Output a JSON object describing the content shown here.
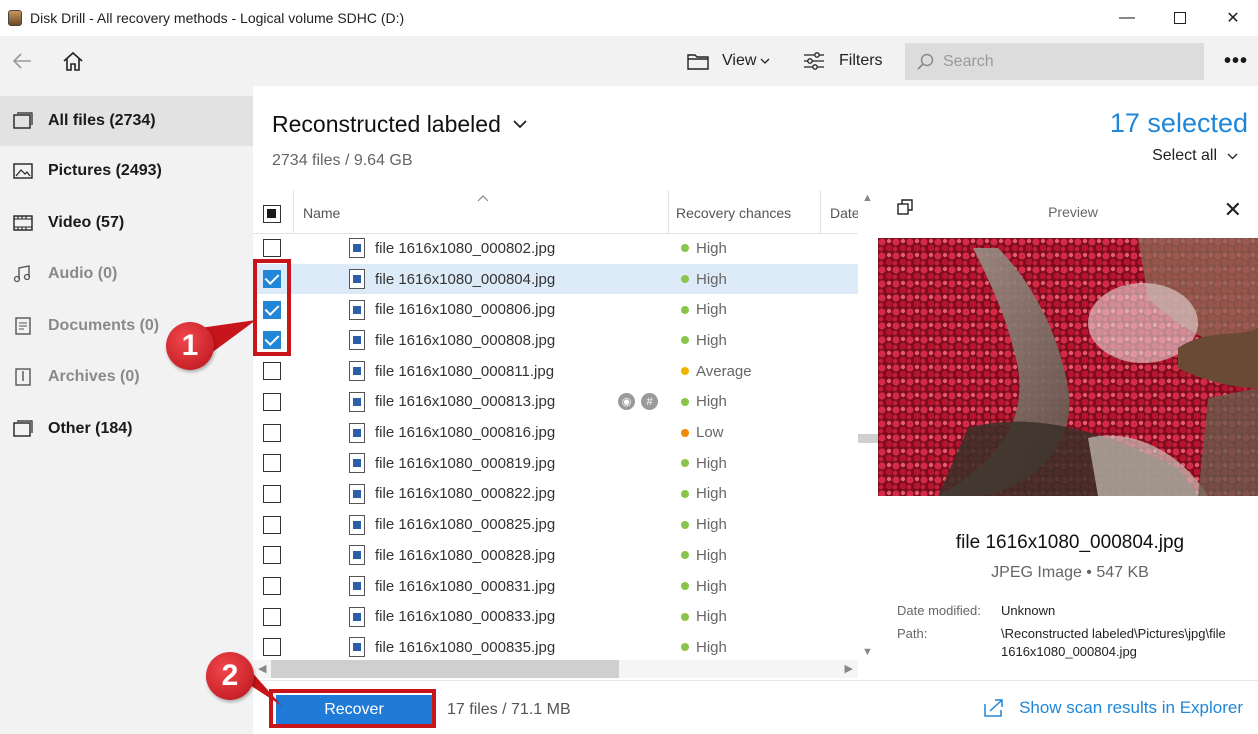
{
  "window": {
    "title": "Disk Drill - All recovery methods - Logical volume SDHC (D:)",
    "minimize": "—",
    "close": "✕"
  },
  "toolbar": {
    "view_label": "View",
    "filters_label": "Filters",
    "search_placeholder": "Search",
    "more": "•••"
  },
  "sidebar": {
    "items": [
      {
        "label": "All files (2734)",
        "icon": "all-files-icon",
        "active": true
      },
      {
        "label": "Pictures (2493)",
        "icon": "pictures-icon"
      },
      {
        "label": "Video (57)",
        "icon": "video-icon"
      },
      {
        "label": "Audio (0)",
        "icon": "audio-icon",
        "disabled": true
      },
      {
        "label": "Documents (0)",
        "icon": "documents-icon",
        "disabled": true
      },
      {
        "label": "Archives (0)",
        "icon": "archives-icon",
        "disabled": true
      },
      {
        "label": "Other (184)",
        "icon": "other-icon"
      }
    ]
  },
  "main": {
    "folder_title": "Reconstructed labeled",
    "summary": "2734 files / 9.64 GB",
    "selected": "17 selected",
    "select_all": "Select all"
  },
  "table": {
    "columns": {
      "name": "Name",
      "chances": "Recovery chances",
      "date": "Date"
    },
    "rows": [
      {
        "name": "file 1616x1080_000802.jpg",
        "chance": "High",
        "checked": false
      },
      {
        "name": "file 1616x1080_000804.jpg",
        "chance": "High",
        "checked": true,
        "highlighted": true
      },
      {
        "name": "file 1616x1080_000806.jpg",
        "chance": "High",
        "checked": true
      },
      {
        "name": "file 1616x1080_000808.jpg",
        "chance": "High",
        "checked": true
      },
      {
        "name": "file 1616x1080_000811.jpg",
        "chance": "Average",
        "checked": false
      },
      {
        "name": "file 1616x1080_000813.jpg",
        "chance": "High",
        "checked": false,
        "actions": true
      },
      {
        "name": "file 1616x1080_000816.jpg",
        "chance": "Low",
        "checked": false
      },
      {
        "name": "file 1616x1080_000819.jpg",
        "chance": "High",
        "checked": false
      },
      {
        "name": "file 1616x1080_000822.jpg",
        "chance": "High",
        "checked": false
      },
      {
        "name": "file 1616x1080_000825.jpg",
        "chance": "High",
        "checked": false
      },
      {
        "name": "file 1616x1080_000828.jpg",
        "chance": "High",
        "checked": false
      },
      {
        "name": "file 1616x1080_000831.jpg",
        "chance": "High",
        "checked": false
      },
      {
        "name": "file 1616x1080_000833.jpg",
        "chance": "High",
        "checked": false
      },
      {
        "name": "file 1616x1080_000835.jpg",
        "chance": "High",
        "checked": false
      }
    ]
  },
  "preview": {
    "title": "Preview",
    "file_name": "file 1616x1080_000804.jpg",
    "file_type": "JPEG Image • 547 KB",
    "date_label": "Date modified:",
    "date_value": "Unknown",
    "path_label": "Path:",
    "path_value": "\\Reconstructed labeled\\Pictures\\jpg\\file 1616x1080_000804.jpg"
  },
  "bottom": {
    "recover_label": "Recover",
    "selection_summary": "17 files / 71.1 MB",
    "explorer_link": "Show scan results in Explorer"
  },
  "annotations": {
    "step1": "1",
    "step2": "2"
  },
  "colors": {
    "accent": "#1f86d8",
    "high": "#8ac44a",
    "average": "#f0b400",
    "low": "#f08a00",
    "callout": "#c8141b"
  }
}
